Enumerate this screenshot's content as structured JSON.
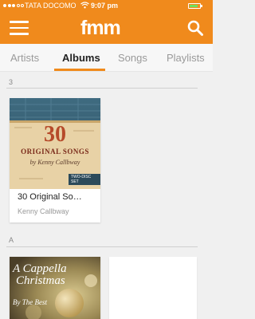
{
  "status_bar": {
    "carrier": "TATA DOCOMO",
    "time": "9:07 pm",
    "battery_color": "#6ee05a"
  },
  "header": {
    "logo": "fmm",
    "menu_icon": "hamburger-menu-icon",
    "search_icon": "search-icon",
    "brand_color": "#f08a1c"
  },
  "tabs": [
    {
      "label": "Artists",
      "active": false
    },
    {
      "label": "Albums",
      "active": true
    },
    {
      "label": "Songs",
      "active": false
    },
    {
      "label": "Playlists",
      "active": false
    }
  ],
  "sections": [
    {
      "letter": "3",
      "albums": [
        {
          "title": "30 Original So…",
          "artist": "Kenny Callbway",
          "art": {
            "number": "30",
            "line1": "ORIGINAL SONGS",
            "line2": "by Kenny Callbway",
            "badge": "TWO-DISC SET"
          }
        }
      ]
    },
    {
      "letter": "A",
      "albums": [
        {
          "art": {
            "line1": "A Cappella",
            "line2": "Christmas",
            "line3": "By The Best"
          }
        }
      ]
    }
  ]
}
